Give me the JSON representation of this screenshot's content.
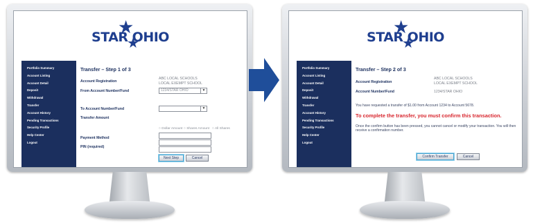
{
  "brand": {
    "logo_text": "STAR OHIO",
    "color": "#1f3f8f"
  },
  "sidebar": {
    "items": [
      {
        "label": "Portfolio Summary"
      },
      {
        "label": "Account Listing"
      },
      {
        "label": "Account Detail"
      },
      {
        "label": "Deposit"
      },
      {
        "label": "Withdrawal"
      },
      {
        "label": "Transfer"
      },
      {
        "label": "Account History"
      },
      {
        "label": "Pending Transactions"
      },
      {
        "label": "Security Profile"
      },
      {
        "label": "Help Center"
      },
      {
        "label": "Logout"
      }
    ],
    "color": "#1b2f5e"
  },
  "step1": {
    "title": "Transfer – Step 1 of 3",
    "account_registration_label": "Account Registration",
    "account_registration_value_line1": "ABC LOCAL SCHOOLS",
    "account_registration_value_line2": "LOCAL EXEMPT SCHOOL",
    "from_account_label": "From Account Number/Fund",
    "from_account_value": "1234/STAR OHIO",
    "to_account_label": "To Account Number/Fund",
    "to_account_value": "",
    "transfer_amount_label": "Transfer Amount",
    "radio_options": [
      "Dollar Amount",
      "Shares Amount",
      "All Shares"
    ],
    "payment_method_label": "Payment Method",
    "pin_label": "PIN (required)",
    "next_button": "Next Step",
    "cancel_button": "Cancel"
  },
  "step2": {
    "title": "Transfer – Step 2 of 3",
    "account_registration_label": "Account Registration",
    "account_registration_value_line1": "ABC LOCAL SCHOOLS",
    "account_registration_value_line2": "LOCAL EXEMPT SCHOOL",
    "account_number_label": "Account Number/Fund",
    "account_number_value": "1234/STAR OHIO",
    "request_text": "You have requested a transfer of $1.00 from Account 1234 to Account 5678.",
    "confirm_text": "To complete the transfer, you must confirm this transaction.",
    "notice_text": "Once the confirm button has been pressed, you cannot cancel or modify your transaction. You will then receive a confirmation number.",
    "confirm_button": "Confirm Transfer",
    "cancel_button": "Cancel",
    "confirm_color": "#d8262e"
  },
  "flow_arrow": {
    "color": "#1f4e9a"
  }
}
